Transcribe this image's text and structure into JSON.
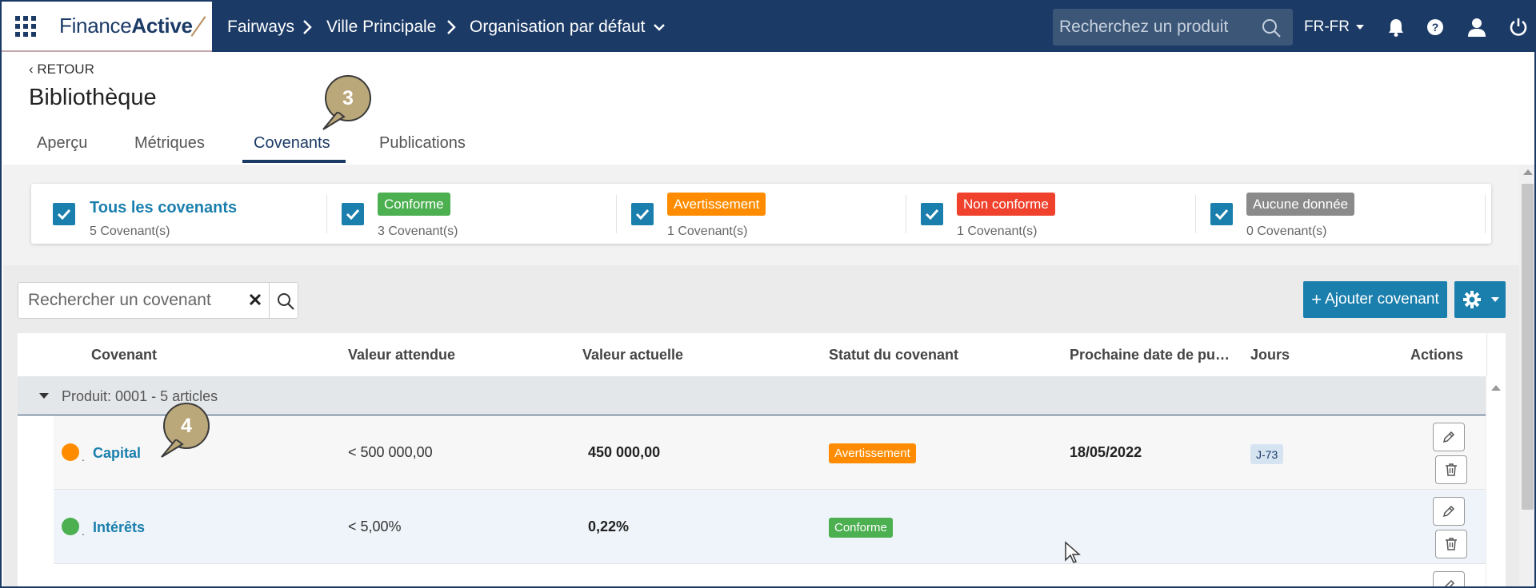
{
  "topbar": {
    "logo_part1": "Finance",
    "logo_part2": "Active",
    "breadcrumb": [
      "Fairways",
      "Ville Principale",
      "Organisation par défaut"
    ],
    "search_placeholder": "Recherchez un produit",
    "language": "FR-FR",
    "icons": [
      "apps-grid-icon",
      "search-icon",
      "bell-icon",
      "help-icon",
      "user-icon",
      "power-icon"
    ]
  },
  "header": {
    "back_label": "RETOUR",
    "title": "Bibliothèque",
    "tabs": [
      {
        "label": "Aperçu",
        "active": false
      },
      {
        "label": "Métriques",
        "active": false
      },
      {
        "label": "Covenants",
        "active": true
      },
      {
        "label": "Publications",
        "active": false
      }
    ]
  },
  "callouts": {
    "tabs": "3",
    "row": "4"
  },
  "filters": [
    {
      "label": "Tous les covenants",
      "count": "5 Covenant(s)",
      "checked": true,
      "color": "#1a7fad"
    },
    {
      "label": "Conforme",
      "count": "3 Covenant(s)",
      "checked": true,
      "color": "#4caf50"
    },
    {
      "label": "Avertissement",
      "count": "1 Covenant(s)",
      "checked": true,
      "color": "#ff8c00"
    },
    {
      "label": "Non conforme",
      "count": "1 Covenant(s)",
      "checked": true,
      "color": "#f0412d"
    },
    {
      "label": "Aucune donnée",
      "count": "0 Covenant(s)",
      "checked": true,
      "color": "#8a8a8a"
    }
  ],
  "toolbar": {
    "search_placeholder": "Rechercher un covenant",
    "add_label": "Ajouter covenant"
  },
  "table": {
    "columns": [
      "Covenant",
      "Valeur attendue",
      "Valeur actuelle",
      "Statut du covenant",
      "Prochaine date de pu…",
      "Jours",
      "Actions"
    ],
    "group_label": "Produit: 0001 - 5 articles",
    "rows": [
      {
        "name": "Capital",
        "dot_color": "#ff8c00",
        "expected": "< 500 000,00",
        "actual": "450 000,00",
        "status": "Avertissement",
        "status_color": "#ff8c00",
        "next_date": "18/05/2022",
        "days": "J-73"
      },
      {
        "name": "Intérêts",
        "dot_color": "#4caf50",
        "expected": "< 5,00%",
        "actual": "0,22%",
        "status": "Conforme",
        "status_color": "#4caf50",
        "next_date": "",
        "days": ""
      }
    ]
  }
}
